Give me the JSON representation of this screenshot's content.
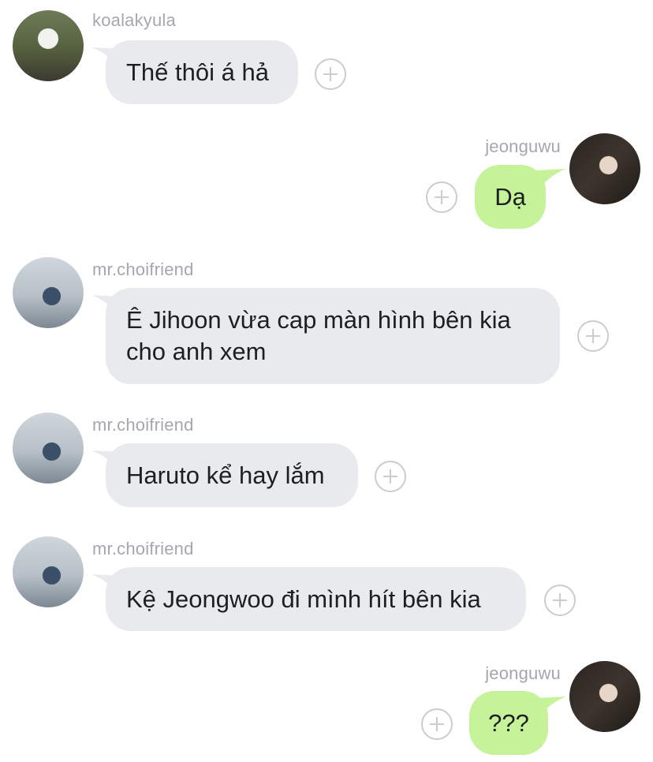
{
  "messages": [
    {
      "user": "koalakyula",
      "text": "Thế thôi á hả",
      "direction": "incoming"
    },
    {
      "user": "jeonguwu",
      "text": "Dạ",
      "direction": "outgoing"
    },
    {
      "user": "mr.choifriend",
      "text_line1": "Ê Jihoon vừa cap màn hình bên kia",
      "text_line2": "cho anh xem",
      "direction": "incoming"
    },
    {
      "user": "mr.choifriend",
      "text": "Haruto kể hay lắm",
      "direction": "incoming"
    },
    {
      "user": "mr.choifriend",
      "text": "Kệ Jeongwoo đi mình hít bên kia",
      "direction": "incoming"
    },
    {
      "user": "jeonguwu",
      "text": "???",
      "direction": "outgoing"
    }
  ],
  "colors": {
    "incoming_bubble": "#e8eaed",
    "outgoing_bubble": "#c6f29a",
    "username": "#a4a7ad",
    "text": "#1e1f22"
  },
  "icons": {
    "reaction_button": "plus-circle-icon"
  }
}
